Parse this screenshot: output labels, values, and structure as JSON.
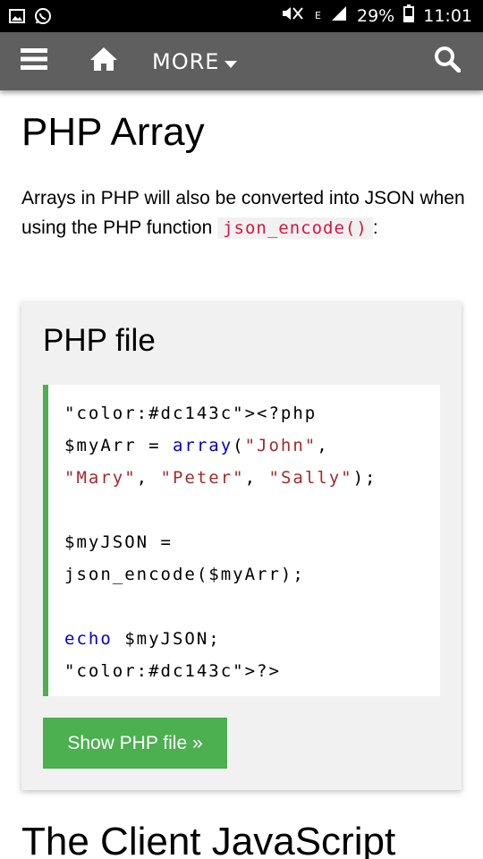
{
  "status_bar": {
    "battery": "29%",
    "time": "11:01",
    "network": "E"
  },
  "navbar": {
    "more_label": "MORE"
  },
  "page": {
    "title": "PHP Array",
    "intro_text": "Arrays in PHP will also be converted into JSON when using the PHP function ",
    "intro_code": "json_encode()",
    "intro_end": ":"
  },
  "example": {
    "heading": "PHP file",
    "code_lines": [
      "<?php",
      "$myArr = array(\"John\",",
      "\"Mary\", \"Peter\", \"Sally\");",
      "",
      "$myJSON =",
      "json_encode($myArr);",
      "",
      "echo $myJSON;",
      "?>"
    ],
    "button_label": "Show PHP file »"
  },
  "next_section": {
    "title": "The Client JavaScript"
  },
  "colors": {
    "toolbar": "#5f5f5f",
    "accent_green": "#4caf50",
    "code_red": "#dc143c",
    "code_string": "#a52a2a",
    "code_keyword": "#0000cd"
  }
}
